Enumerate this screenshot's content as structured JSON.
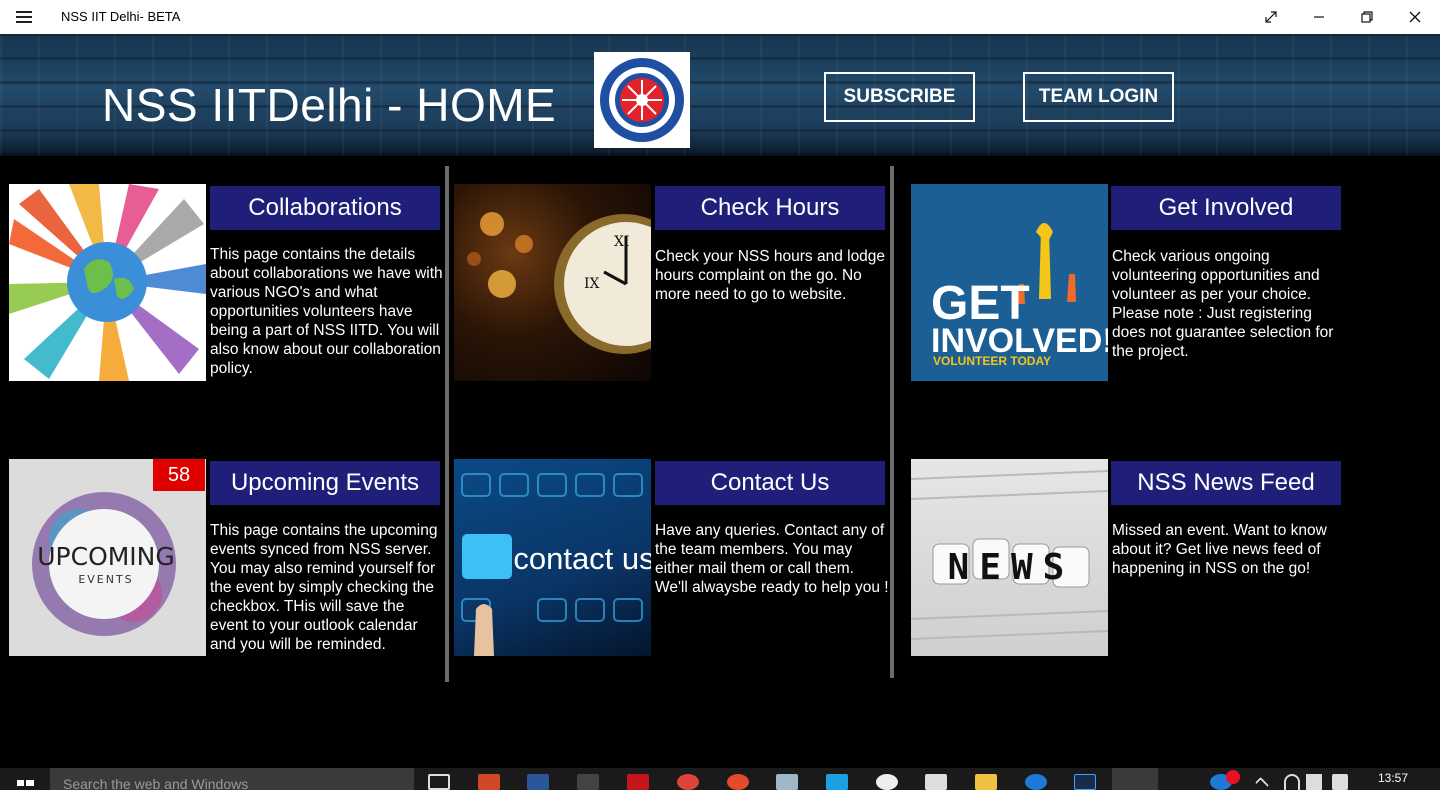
{
  "window": {
    "title": "NSS IIT Delhi- BETA",
    "menu_icon": "hamburger-icon"
  },
  "header": {
    "title": "NSS IITDelhi - HOME",
    "logo_alt": "National Service Scheme logo",
    "subscribe_label": "SUBSCRIBE",
    "team_login_label": "TEAM LOGIN"
  },
  "tiles": [
    {
      "title": "Collaborations",
      "desc": "This page contains the details about collaborations we have with various NGO's and what opportunities volunteers have being a part of NSS IITD. You will also know about our collaboration policy."
    },
    {
      "title": "Check Hours",
      "desc": "Check your NSS hours and lodge hours complaint on the go. No more need to go to website."
    },
    {
      "title": "Get Involved",
      "desc": "Check various ongoing volunteering opportunities and volunteer as per your choice. Please note : Just registering does not guarantee selection for the project.",
      "image_text_1": "GET",
      "image_text_2": "INVOLVED!",
      "image_text_3": "VOLUNTEER TODAY"
    },
    {
      "title": "Upcoming Events",
      "desc": "This page contains the upcoming events synced from NSS server. You may also remind yourself for the event by simply checking the checkbox. THis will save the event to your outlook calendar and you will be reminded.",
      "badge": "58",
      "image_text_1": "UPCOMING",
      "image_text_2": "EVENTS"
    },
    {
      "title": "Contact Us",
      "desc": "Have any queries. Contact any of the team members. You may either mail them or call them. We'll alwaysbe ready to help you !",
      "image_text_1": "contact us"
    },
    {
      "title": "NSS News Feed",
      "desc": "Missed an event. Want to know about it? Get live news feed of happening in NSS on the go!",
      "image_text_1": "NEWS"
    }
  ],
  "taskbar": {
    "search_placeholder": "Search the web and Windows",
    "clock": "13:57"
  },
  "colors": {
    "tile_title_bg": "#1f1f7a",
    "badge": "#e10000",
    "background": "#000000"
  }
}
